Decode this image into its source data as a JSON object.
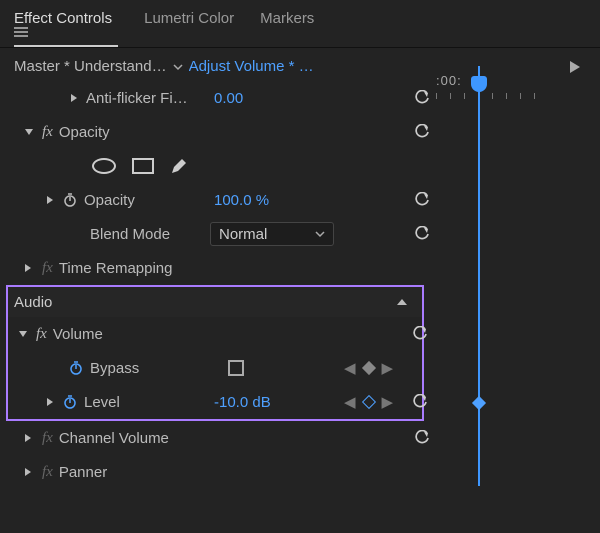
{
  "tabs": {
    "effect_controls": "Effect Controls",
    "lumetri_color": "Lumetri Color",
    "markers": "Markers"
  },
  "breadcrumb": {
    "master": "Master * Understand…",
    "clip": "Adjust Volume * …"
  },
  "timeline": {
    "timecode": ":00:"
  },
  "video": {
    "anti_flicker": {
      "label": "Anti-flicker Fi…",
      "value": "0.00"
    },
    "opacity": {
      "label": "Opacity",
      "prop_label": "Opacity",
      "value": "100.0 %",
      "blend_label": "Blend Mode",
      "blend_value": "Normal"
    },
    "time_remapping": {
      "label": "Time Remapping"
    }
  },
  "audio": {
    "section": "Audio",
    "volume": {
      "label": "Volume",
      "bypass": {
        "label": "Bypass"
      },
      "level": {
        "label": "Level",
        "value": "-10.0 dB"
      }
    },
    "channel_volume": {
      "label": "Channel Volume"
    },
    "panner": {
      "label": "Panner"
    }
  },
  "colors": {
    "accent": "#4ea0ff",
    "highlight": "#a97bff"
  }
}
